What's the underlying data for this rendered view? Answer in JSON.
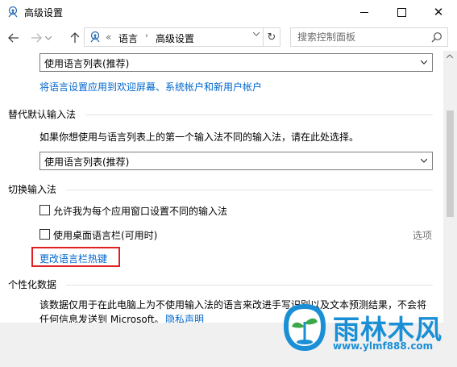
{
  "window": {
    "title": "高级设置",
    "icon": "control-panel-icon"
  },
  "nav": {
    "breadcrumb_sep": "«",
    "breadcrumb": [
      "语言",
      "高级设置"
    ],
    "search_placeholder": "搜索控制面板"
  },
  "content": {
    "dropdown1_value": "使用语言列表(推荐)",
    "apply_link": "将语言设置应用到欢迎屏幕、系统帐户和新用户帐户",
    "override_section": {
      "title": "替代默认输入法",
      "description": "如果你想使用与语言列表上的第一个输入法不同的输入法，请在此处选择。",
      "dropdown_value": "使用语言列表(推荐)"
    },
    "switch_section": {
      "title": "切换输入法",
      "checkbox1_label": "允许我为每个应用窗口设置不同的输入法",
      "checkbox1_checked": false,
      "checkbox2_label": "使用桌面语言栏(可用时)",
      "checkbox2_checked": false,
      "options_label": "选项",
      "hotkeys_link": "更改语言栏热键"
    },
    "personalization_section": {
      "title": "个性化数据",
      "text_line1": "该数据仅用于在此电脑上为不使用输入法的语言来改进手写识别以及文本预测结果，不会将",
      "text_line2": "任何信息发送到 Microsoft。",
      "privacy_link": "隐私声明"
    }
  },
  "watermark": {
    "brand": "雨林木风",
    "url": "www.ylmf888.com"
  },
  "colors": {
    "link": "#0066cc",
    "highlight": "#e02020",
    "watermark": "#1a8fd6"
  }
}
